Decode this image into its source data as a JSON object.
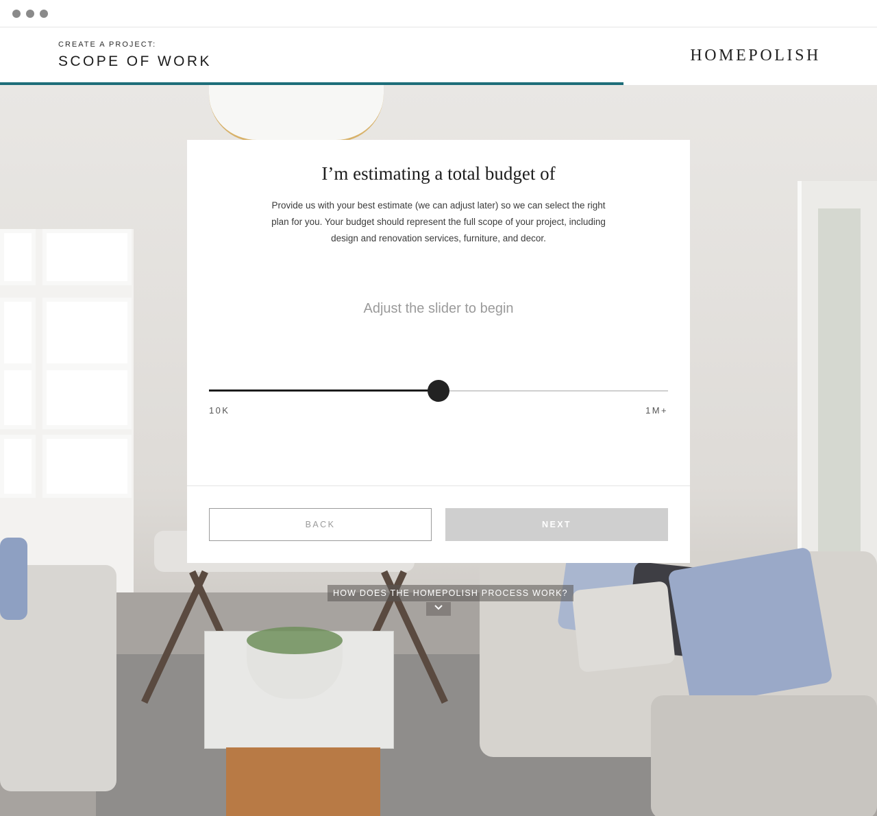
{
  "header": {
    "eyebrow": "CREATE A PROJECT:",
    "title": "SCOPE OF WORK",
    "brand": "HOMEPOLISH",
    "progress_fraction": 0.711,
    "accent_color": "#1e6e7a"
  },
  "modal": {
    "title": "I’m estimating a total budget of",
    "description": "Provide us with your best estimate (we can adjust later) so we can select the right plan for you. Your budget should represent the full scope of your project, including design and renovation services, furniture, and decor.",
    "slider_hint": "Adjust the slider to begin",
    "slider": {
      "min_label": "10K",
      "max_label": "1M+",
      "value_fraction": 0.5
    },
    "back_label": "BACK",
    "next_label": "NEXT"
  },
  "footer_link": {
    "label": "HOW DOES THE HOMEPOLISH PROCESS WORK?",
    "icon": "chevron-down-icon"
  }
}
